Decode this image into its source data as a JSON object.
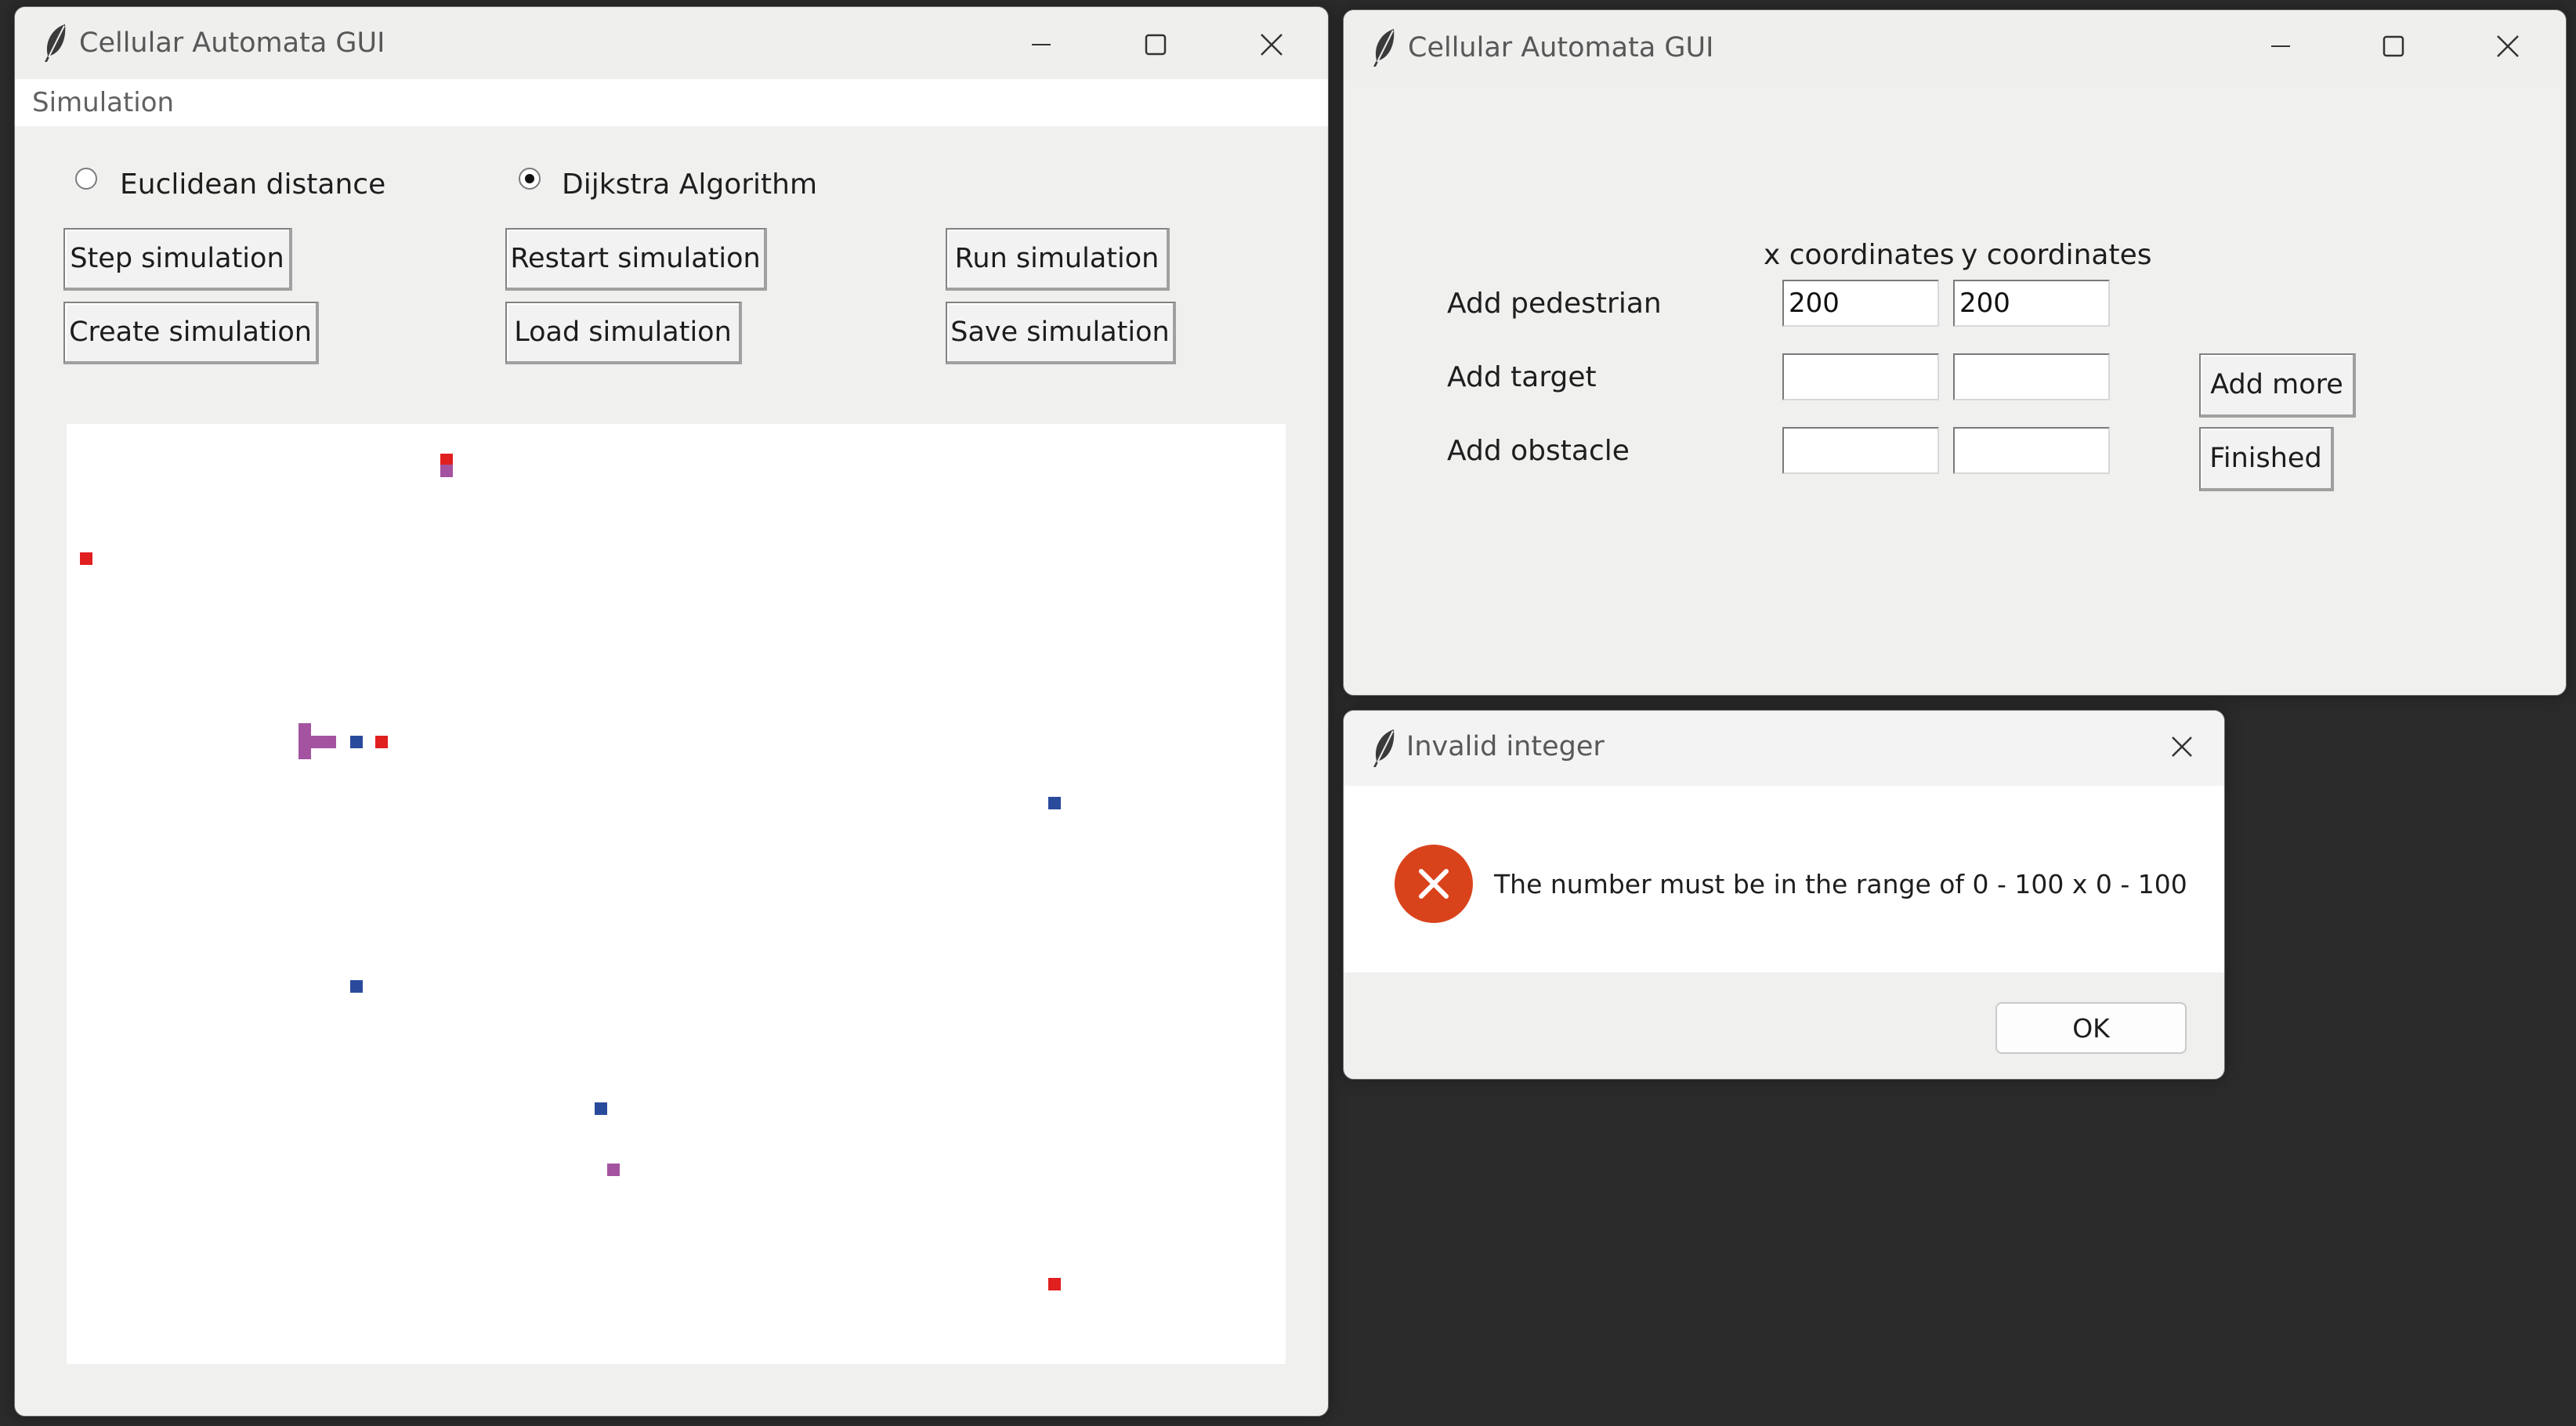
{
  "main_window": {
    "title": "Cellular Automata GUI",
    "menu": [
      "Simulation"
    ],
    "radio_options": [
      {
        "label": "Euclidean distance",
        "selected": false
      },
      {
        "label": "Dijkstra Algorithm",
        "selected": true
      }
    ],
    "buttons": {
      "step": "Step simulation",
      "restart": "Restart simulation",
      "run": "Run simulation",
      "create": "Create simulation",
      "load": "Load simulation",
      "save": "Save simulation"
    },
    "legend_colors": {
      "target": "#e01f1f",
      "pedestrian": "#2a4a9c",
      "path": "#a453a0"
    }
  },
  "add_window": {
    "title": "Cellular Automata GUI",
    "column_headers": [
      "x coordinates",
      "y coordinates"
    ],
    "rows": [
      {
        "label": "Add pedestrian",
        "x_value": "200",
        "y_value": "200"
      },
      {
        "label": "Add target",
        "x_value": "",
        "y_value": ""
      },
      {
        "label": "Add obstacle",
        "x_value": "",
        "y_value": ""
      }
    ],
    "buttons": {
      "add_more": "Add more",
      "finished": "Finished"
    }
  },
  "error_dialog": {
    "title": "Invalid integer",
    "message": "The number must be in the range of 0 - 100 x 0 - 100",
    "ok_label": "OK",
    "icon": "error-icon",
    "icon_color": "#d9431c"
  },
  "window_controls": [
    "minimize-icon",
    "maximize-icon",
    "close-icon"
  ]
}
